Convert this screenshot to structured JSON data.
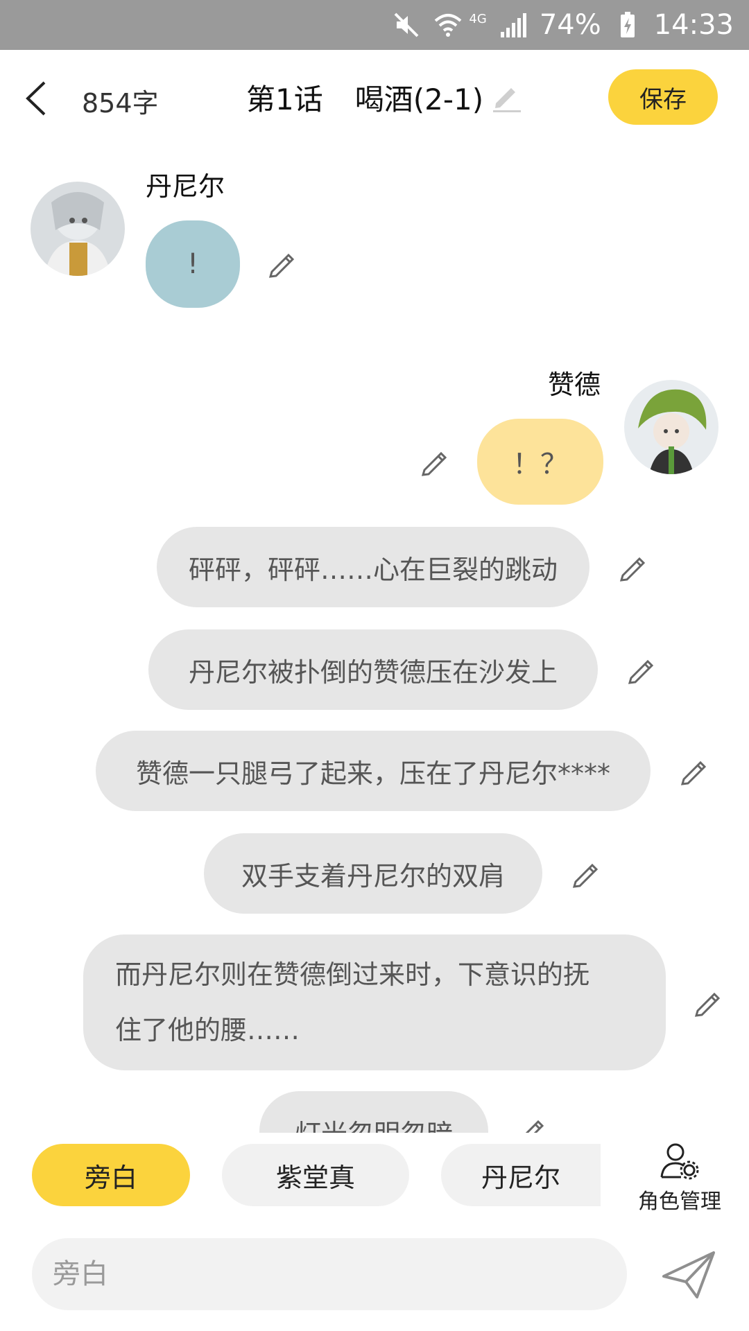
{
  "status_bar": {
    "battery": "74%",
    "time": "14:33",
    "network": "4G"
  },
  "header": {
    "word_count": "854字",
    "chapter": "第1话",
    "title": "喝酒(2-1)",
    "save_label": "保存"
  },
  "messages": [
    {
      "speaker": "丹尼尔",
      "text": "!",
      "bubble_color": "#a9ccd4"
    },
    {
      "speaker": "赞德",
      "text": "！？",
      "bubble_color": "#fde39a"
    },
    {
      "text": "砰砰，砰砰……心在巨裂的跳动"
    },
    {
      "text": "丹尼尔被扑倒的赞德压在沙发上"
    },
    {
      "text": "赞德一只腿弓了起来，压在了丹尼尔****"
    },
    {
      "text": "双手支着丹尼尔的双肩"
    },
    {
      "text_line1": "而丹尼尔则在赞德倒过来时，下意识的抚",
      "text_line2": "住了他的腰……"
    },
    {
      "text": "灯光忽明忽暗"
    }
  ],
  "roles": {
    "items": [
      "旁白",
      "紫堂真",
      "丹尼尔"
    ],
    "active": "旁白",
    "manage_label": "角色管理"
  },
  "input": {
    "placeholder": "旁白"
  },
  "colors": {
    "accent": "#fbd33d",
    "narration_bubble": "#e6e6e6",
    "status_bar": "#9a9a9a"
  }
}
